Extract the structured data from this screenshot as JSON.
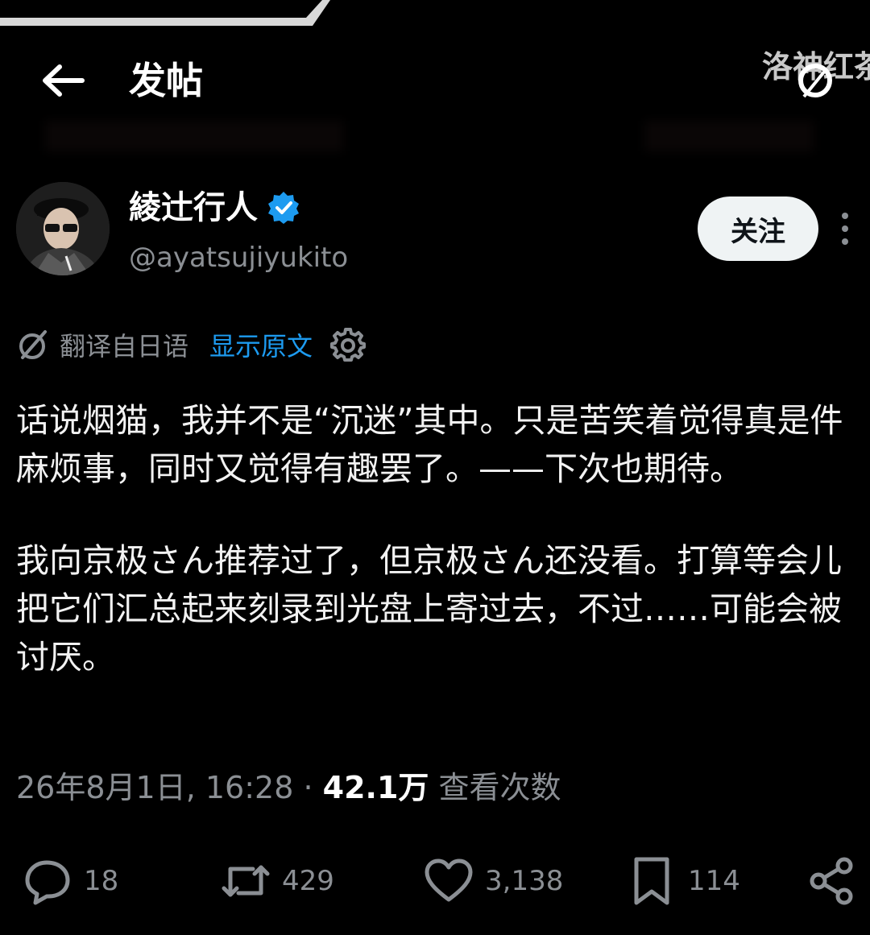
{
  "header": {
    "title": "发帖",
    "watermark_text": "洛神红茶"
  },
  "author": {
    "name": "綾辻行人",
    "handle": "@ayatsujiyukito",
    "follow_label": "关注"
  },
  "translation": {
    "label": "翻译自日语",
    "show_original": "显示原文"
  },
  "post": {
    "paragraphs": [
      "话说烟猫，我并不是“沉迷”其中。只是苦笑着觉得真是件麻烦事，同时又觉得有趣罢了。——下次也期待。",
      "我向京极さん推荐过了，但京极さん还没看。打算等会儿把它们汇总起来刻录到光盘上寄过去，不过……可能会被讨厌。"
    ]
  },
  "meta": {
    "timestamp": "26年8月1日, 16:28",
    "separator": "·",
    "views_count": "42.1万",
    "views_label": "查看次数"
  },
  "actions": {
    "replies": "18",
    "reposts": "429",
    "likes": "3,138",
    "bookmarks": "114"
  },
  "colors": {
    "background": "#000000",
    "accent": "#1d9bf0",
    "muted": "#8b8f94",
    "text": "#f2f2f2"
  },
  "icons": [
    "back-arrow-icon",
    "verified-badge-icon",
    "more-options-icon",
    "translate-icon",
    "gear-icon",
    "reply-icon",
    "repost-icon",
    "like-icon",
    "bookmark-icon",
    "share-icon"
  ]
}
